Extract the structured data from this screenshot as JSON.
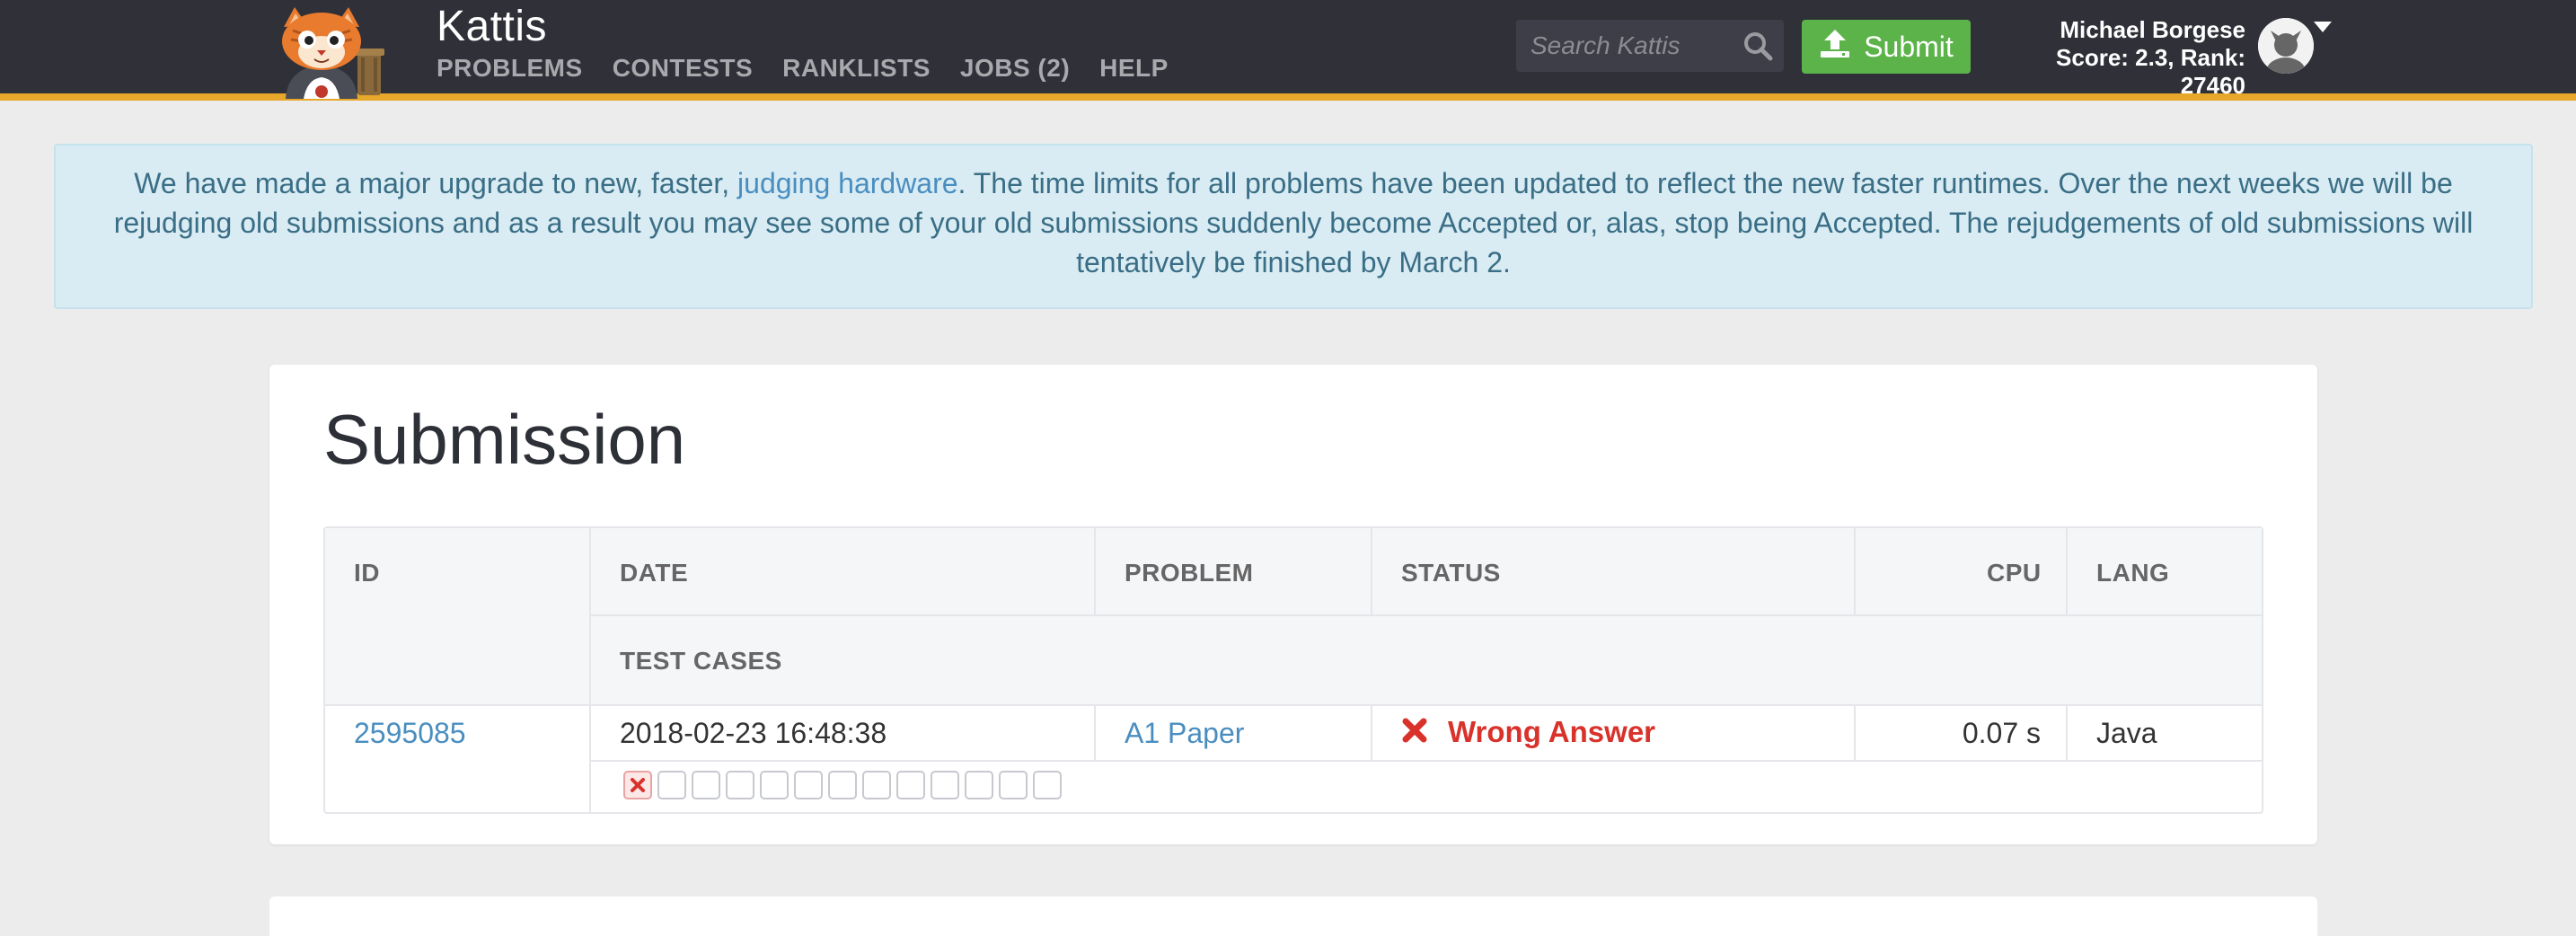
{
  "brand": {
    "name": "Kattis"
  },
  "nav": {
    "items": [
      {
        "label": "PROBLEMS"
      },
      {
        "label": "CONTESTS"
      },
      {
        "label": "RANKLISTS"
      },
      {
        "label": "JOBS (2)"
      },
      {
        "label": "HELP"
      }
    ]
  },
  "search": {
    "placeholder": "Search Kattis"
  },
  "submit": {
    "label": "Submit"
  },
  "user": {
    "name": "Michael Borgese",
    "stats": "Score: 2.3, Rank: 27460"
  },
  "alert": {
    "before": "We have made a major upgrade to new, faster, ",
    "link": "judging hardware",
    "after": ". The time limits for all problems have been updated to reflect the new faster runtimes. Over the next weeks we will be rejudging old submissions and as a result you may see some of your old submissions suddenly become Accepted or, alas, stop being Accepted. The rejudgements of old submissions will tentatively be finished by March 2."
  },
  "submission": {
    "title": "Submission",
    "headers": {
      "id": "ID",
      "date": "DATE",
      "problem": "PROBLEM",
      "status": "STATUS",
      "cpu": "CPU",
      "lang": "LANG",
      "test_cases": "TEST CASES"
    },
    "row": {
      "id": "2595085",
      "date": "2018-02-23 16:48:38",
      "problem": "A1 Paper",
      "status": "Wrong Answer",
      "cpu": "0.07 s",
      "lang": "Java"
    },
    "test_cases": {
      "total": 13,
      "results": [
        "fail",
        "none",
        "none",
        "none",
        "none",
        "none",
        "none",
        "none",
        "none",
        "none",
        "none",
        "none",
        "none"
      ]
    }
  },
  "colors": {
    "navbar": "#2f3038",
    "accent_bar": "#e6a72a",
    "submit_green": "#5cb34a",
    "link_blue": "#4a8ec0",
    "wrong_red": "#d8322b",
    "alert_bg": "#d9ecf3"
  }
}
